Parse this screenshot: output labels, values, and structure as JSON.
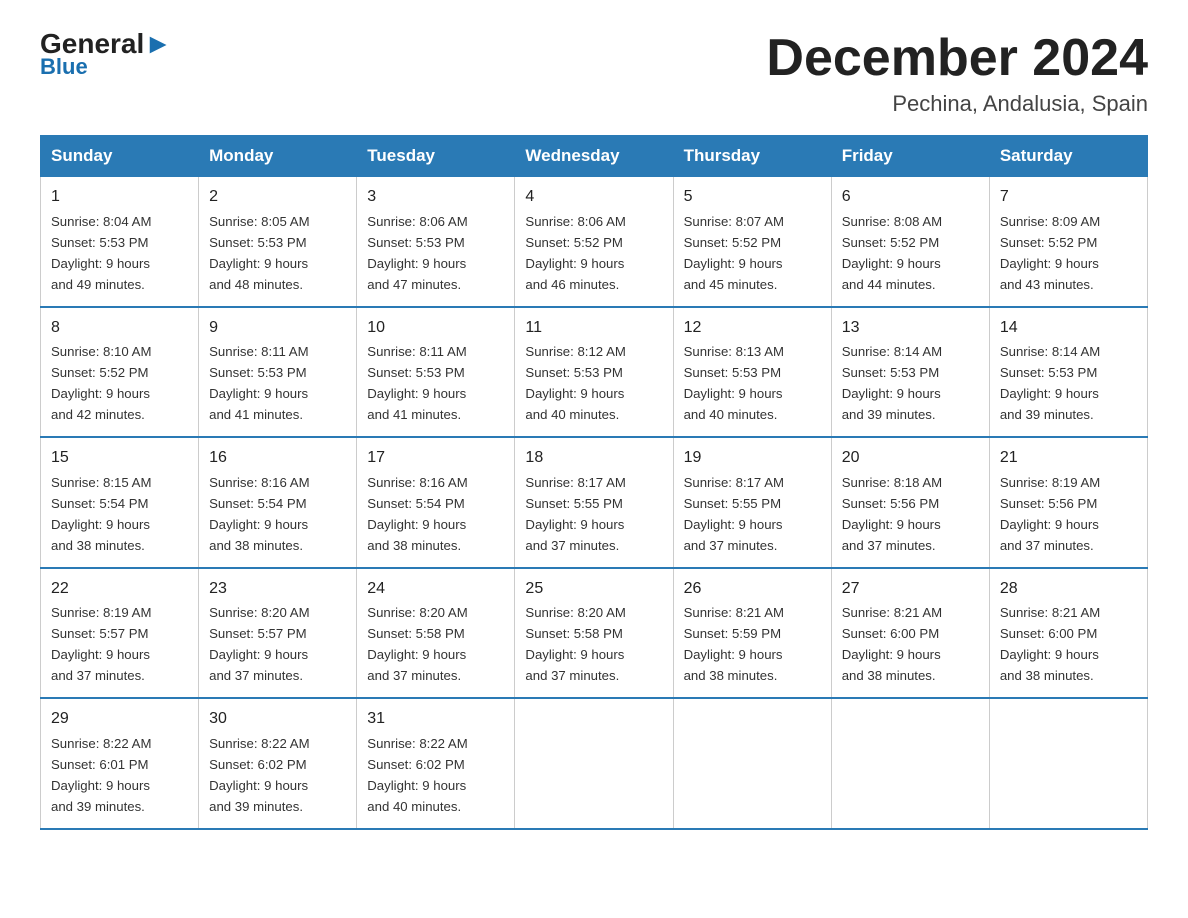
{
  "header": {
    "logo_general": "General",
    "logo_triangle": "",
    "logo_blue": "Blue",
    "month_title": "December 2024",
    "location": "Pechina, Andalusia, Spain"
  },
  "days_of_week": [
    "Sunday",
    "Monday",
    "Tuesday",
    "Wednesday",
    "Thursday",
    "Friday",
    "Saturday"
  ],
  "weeks": [
    [
      {
        "day": "1",
        "sunrise": "8:04 AM",
        "sunset": "5:53 PM",
        "daylight": "9 hours and 49 minutes."
      },
      {
        "day": "2",
        "sunrise": "8:05 AM",
        "sunset": "5:53 PM",
        "daylight": "9 hours and 48 minutes."
      },
      {
        "day": "3",
        "sunrise": "8:06 AM",
        "sunset": "5:53 PM",
        "daylight": "9 hours and 47 minutes."
      },
      {
        "day": "4",
        "sunrise": "8:06 AM",
        "sunset": "5:52 PM",
        "daylight": "9 hours and 46 minutes."
      },
      {
        "day": "5",
        "sunrise": "8:07 AM",
        "sunset": "5:52 PM",
        "daylight": "9 hours and 45 minutes."
      },
      {
        "day": "6",
        "sunrise": "8:08 AM",
        "sunset": "5:52 PM",
        "daylight": "9 hours and 44 minutes."
      },
      {
        "day": "7",
        "sunrise": "8:09 AM",
        "sunset": "5:52 PM",
        "daylight": "9 hours and 43 minutes."
      }
    ],
    [
      {
        "day": "8",
        "sunrise": "8:10 AM",
        "sunset": "5:52 PM",
        "daylight": "9 hours and 42 minutes."
      },
      {
        "day": "9",
        "sunrise": "8:11 AM",
        "sunset": "5:53 PM",
        "daylight": "9 hours and 41 minutes."
      },
      {
        "day": "10",
        "sunrise": "8:11 AM",
        "sunset": "5:53 PM",
        "daylight": "9 hours and 41 minutes."
      },
      {
        "day": "11",
        "sunrise": "8:12 AM",
        "sunset": "5:53 PM",
        "daylight": "9 hours and 40 minutes."
      },
      {
        "day": "12",
        "sunrise": "8:13 AM",
        "sunset": "5:53 PM",
        "daylight": "9 hours and 40 minutes."
      },
      {
        "day": "13",
        "sunrise": "8:14 AM",
        "sunset": "5:53 PM",
        "daylight": "9 hours and 39 minutes."
      },
      {
        "day": "14",
        "sunrise": "8:14 AM",
        "sunset": "5:53 PM",
        "daylight": "9 hours and 39 minutes."
      }
    ],
    [
      {
        "day": "15",
        "sunrise": "8:15 AM",
        "sunset": "5:54 PM",
        "daylight": "9 hours and 38 minutes."
      },
      {
        "day": "16",
        "sunrise": "8:16 AM",
        "sunset": "5:54 PM",
        "daylight": "9 hours and 38 minutes."
      },
      {
        "day": "17",
        "sunrise": "8:16 AM",
        "sunset": "5:54 PM",
        "daylight": "9 hours and 38 minutes."
      },
      {
        "day": "18",
        "sunrise": "8:17 AM",
        "sunset": "5:55 PM",
        "daylight": "9 hours and 37 minutes."
      },
      {
        "day": "19",
        "sunrise": "8:17 AM",
        "sunset": "5:55 PM",
        "daylight": "9 hours and 37 minutes."
      },
      {
        "day": "20",
        "sunrise": "8:18 AM",
        "sunset": "5:56 PM",
        "daylight": "9 hours and 37 minutes."
      },
      {
        "day": "21",
        "sunrise": "8:19 AM",
        "sunset": "5:56 PM",
        "daylight": "9 hours and 37 minutes."
      }
    ],
    [
      {
        "day": "22",
        "sunrise": "8:19 AM",
        "sunset": "5:57 PM",
        "daylight": "9 hours and 37 minutes."
      },
      {
        "day": "23",
        "sunrise": "8:20 AM",
        "sunset": "5:57 PM",
        "daylight": "9 hours and 37 minutes."
      },
      {
        "day": "24",
        "sunrise": "8:20 AM",
        "sunset": "5:58 PM",
        "daylight": "9 hours and 37 minutes."
      },
      {
        "day": "25",
        "sunrise": "8:20 AM",
        "sunset": "5:58 PM",
        "daylight": "9 hours and 37 minutes."
      },
      {
        "day": "26",
        "sunrise": "8:21 AM",
        "sunset": "5:59 PM",
        "daylight": "9 hours and 38 minutes."
      },
      {
        "day": "27",
        "sunrise": "8:21 AM",
        "sunset": "6:00 PM",
        "daylight": "9 hours and 38 minutes."
      },
      {
        "day": "28",
        "sunrise": "8:21 AM",
        "sunset": "6:00 PM",
        "daylight": "9 hours and 38 minutes."
      }
    ],
    [
      {
        "day": "29",
        "sunrise": "8:22 AM",
        "sunset": "6:01 PM",
        "daylight": "9 hours and 39 minutes."
      },
      {
        "day": "30",
        "sunrise": "8:22 AM",
        "sunset": "6:02 PM",
        "daylight": "9 hours and 39 minutes."
      },
      {
        "day": "31",
        "sunrise": "8:22 AM",
        "sunset": "6:02 PM",
        "daylight": "9 hours and 40 minutes."
      },
      null,
      null,
      null,
      null
    ]
  ]
}
